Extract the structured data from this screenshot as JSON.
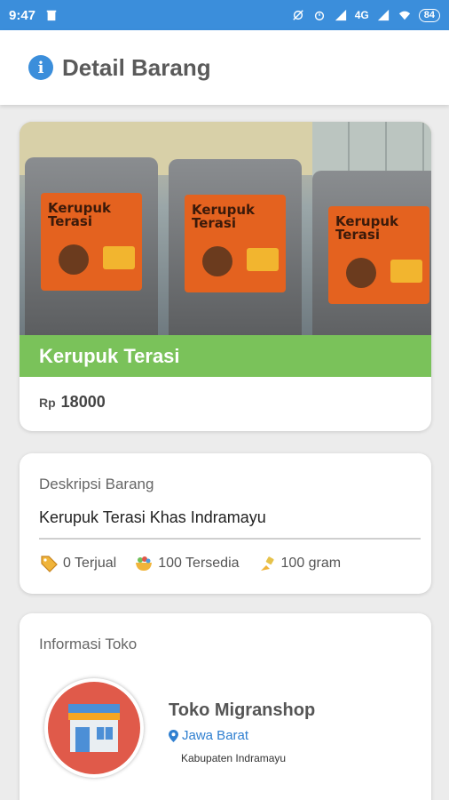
{
  "statusbar": {
    "time": "9:47",
    "network": "4G",
    "battery": "84"
  },
  "appbar": {
    "title": "Detail Barang",
    "icon": "info-icon"
  },
  "product": {
    "bag_text": "Kerupuk Terasi",
    "name": "Kerupuk Terasi",
    "currency": "Rp",
    "price": "18000"
  },
  "description": {
    "title": "Deskripsi Barang",
    "text": "Kerupuk Terasi Khas Indramayu",
    "sold": "0 Terjual",
    "stock": "100 Tersedia",
    "weight": "100 gram"
  },
  "store": {
    "title": "Informasi Toko",
    "name": "Toko Migranshop",
    "province": "Jawa Barat",
    "city": "Kabupaten Indramayu"
  },
  "colors": {
    "statusbar": "#3b8edb",
    "name_bar": "#7ac25a",
    "location": "#2f7fd0",
    "store_avatar": "#e05a4a"
  }
}
